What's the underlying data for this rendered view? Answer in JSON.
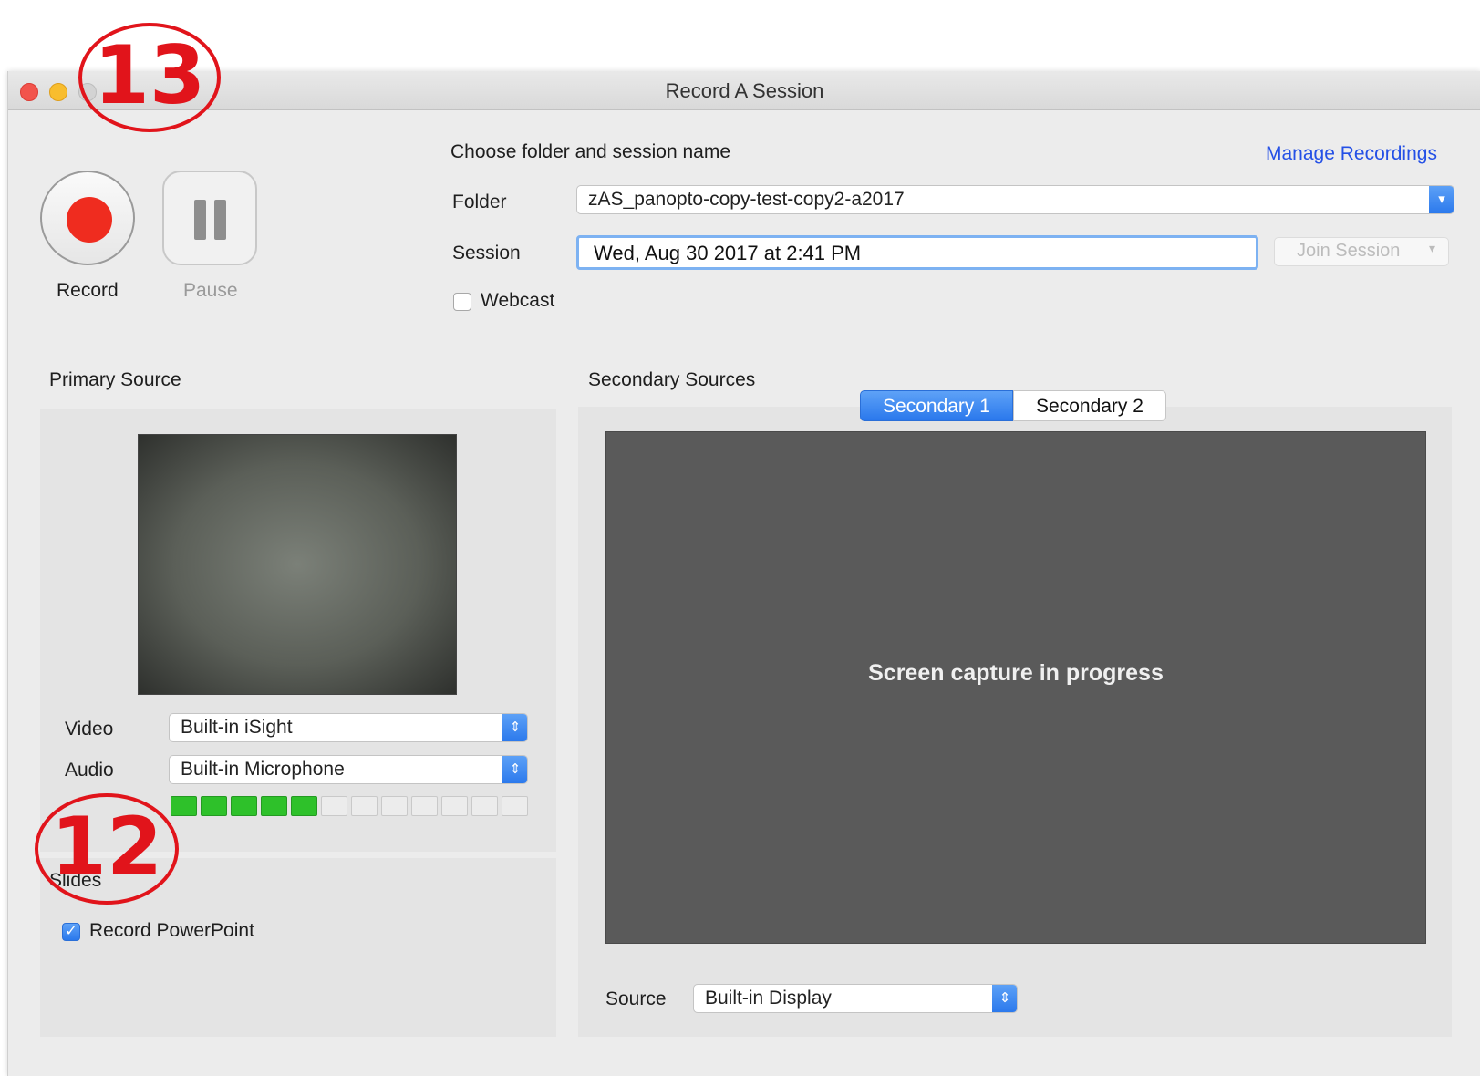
{
  "window": {
    "title": "Record A Session"
  },
  "controls": {
    "record_label": "Record",
    "pause_label": "Pause"
  },
  "session_setup": {
    "heading": "Choose folder and session name",
    "manage_link": "Manage Recordings",
    "folder_label": "Folder",
    "folder_value": "zAS_panopto-copy-test-copy2-a2017",
    "session_label": "Session",
    "session_value": "Wed, Aug 30 2017 at 2:41 PM",
    "join_button": "Join Session",
    "webcast_label": "Webcast",
    "webcast_checked": false
  },
  "primary": {
    "heading": "Primary Source",
    "video_label": "Video",
    "video_value": "Built-in iSight",
    "audio_label": "Audio",
    "audio_value": "Built-in Microphone",
    "audio_level_segments_on": 5,
    "audio_level_segments_total": 12
  },
  "slides": {
    "heading": "Slides",
    "record_ppt_label": "Record PowerPoint",
    "record_ppt_checked": true
  },
  "secondary": {
    "heading": "Secondary Sources",
    "tabs": [
      "Secondary 1",
      "Secondary 2"
    ],
    "active_tab": "Secondary 1",
    "status_text": "Screen capture in progress",
    "source_label": "Source",
    "source_value": "Built-in Display"
  },
  "annotations": {
    "callout_13": "13",
    "callout_12": "12",
    "color": "#e1141b"
  },
  "colors": {
    "accent": "#2a78ec",
    "record": "#ef2c1f",
    "meter_on": "#2ec12a",
    "link": "#2450e6"
  }
}
